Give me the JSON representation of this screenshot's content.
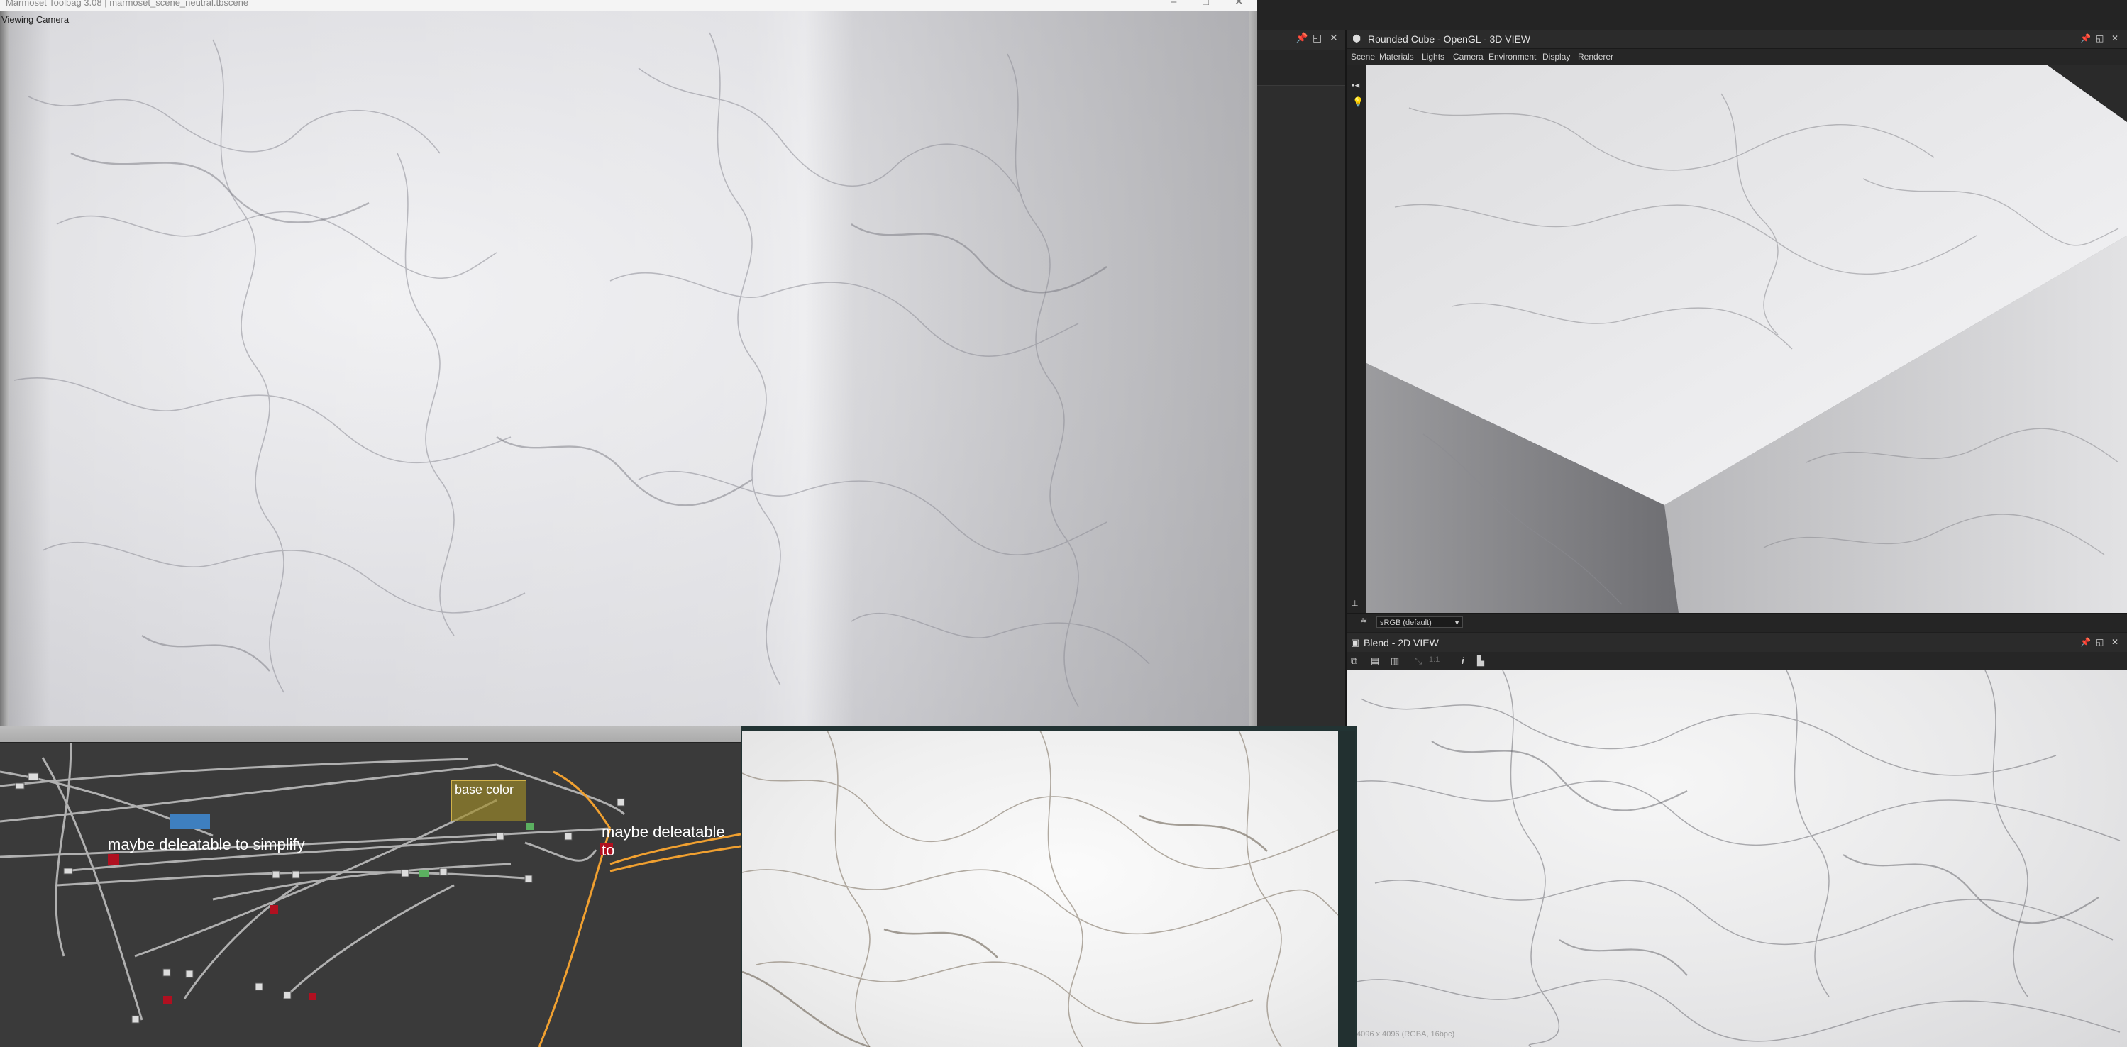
{
  "marmoset": {
    "title": "Marmoset Toolbag 3.08 | marmoset_scene_neutral.tbscene",
    "camera_label": "Viewing Camera",
    "window_controls": [
      "–",
      "□",
      "✕"
    ]
  },
  "left_dock": {
    "controls": [
      "📌",
      "◱",
      "✕"
    ]
  },
  "view3d": {
    "title": "Rounded Cube - OpenGL - 3D VIEW",
    "menu": [
      "Scene",
      "Materials",
      "Lights",
      "Camera",
      "Environment",
      "Display",
      "Renderer"
    ],
    "colorspace": "sRGB (default)",
    "controls": [
      "📌",
      "◱",
      "✕"
    ]
  },
  "view2d": {
    "title": "Blend - 2D VIEW",
    "zoom": "1:1",
    "status": "4096 x 4096 (RGBA, 16bpc)",
    "controls": [
      "📌",
      "◱",
      "✕"
    ]
  },
  "graph": {
    "frame_label": "base color",
    "comment_left": "maybe deleatable to simplify",
    "comment_right": "maybe deleatable to"
  },
  "colors": {
    "panel_dark": "#262626",
    "header": "#2b2b2b",
    "graph_bg": "#3a3a3a",
    "link_gray": "#bdbdbd",
    "link_orange": "#f0a030",
    "frame_olive": "#a08c28"
  }
}
